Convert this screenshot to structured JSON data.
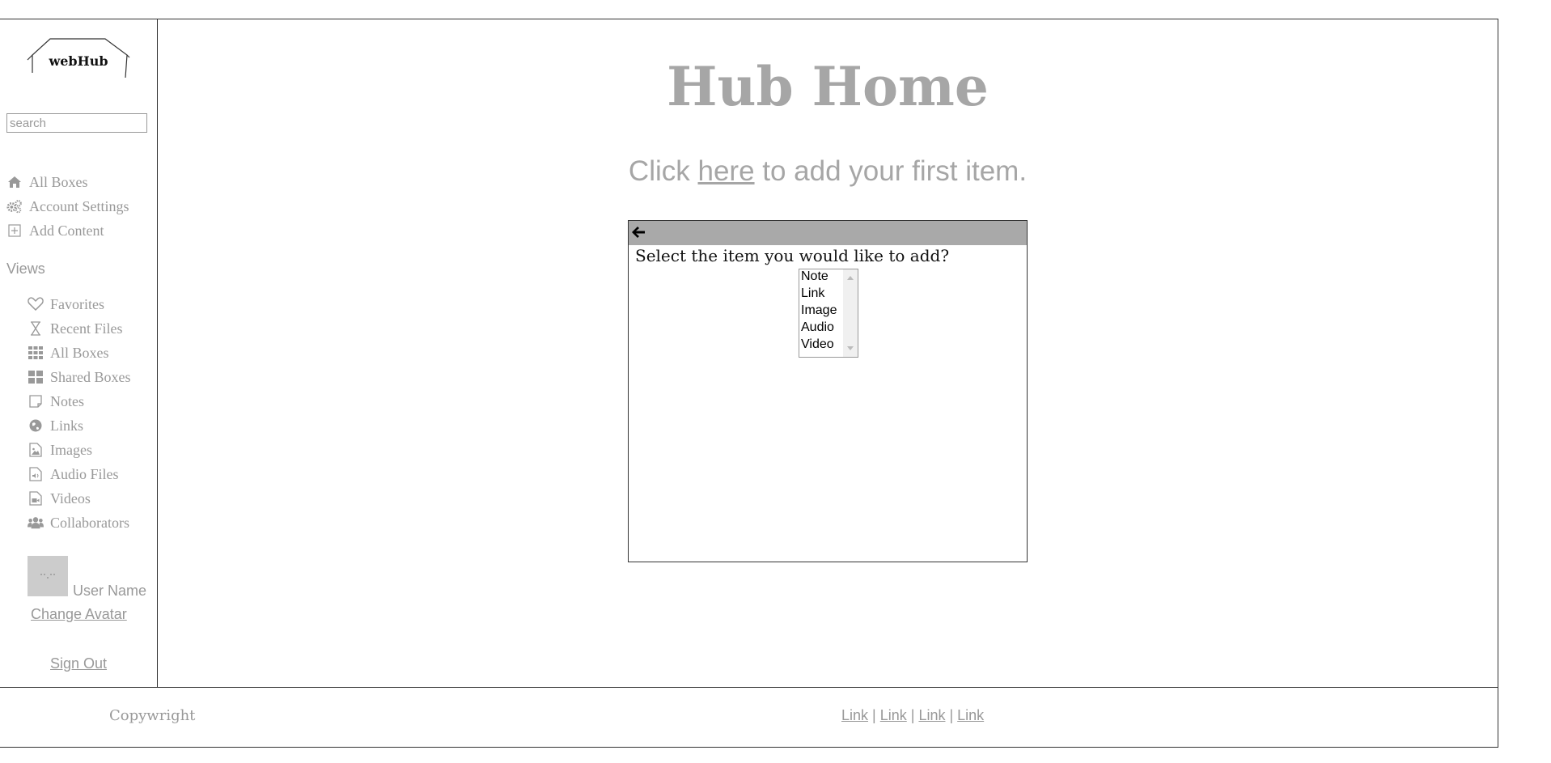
{
  "app": {
    "logo_text": "webHub"
  },
  "sidebar": {
    "search_placeholder": "search",
    "nav": [
      {
        "label": "All Boxes",
        "icon": "home-icon"
      },
      {
        "label": "Account Settings",
        "icon": "gears-icon"
      },
      {
        "label": "Add Content",
        "icon": "plus-square-icon"
      }
    ],
    "views_heading": "Views",
    "views": [
      {
        "label": "Favorites",
        "icon": "heart-icon"
      },
      {
        "label": "Recent Files",
        "icon": "hourglass-icon"
      },
      {
        "label": "All Boxes",
        "icon": "grid-icon"
      },
      {
        "label": "Shared Boxes",
        "icon": "tiles-icon"
      },
      {
        "label": "Notes",
        "icon": "note-icon"
      },
      {
        "label": "Links",
        "icon": "globe-icon"
      },
      {
        "label": "Images",
        "icon": "image-file-icon"
      },
      {
        "label": "Audio Files",
        "icon": "audio-file-icon"
      },
      {
        "label": "Videos",
        "icon": "video-file-icon"
      },
      {
        "label": "Collaborators",
        "icon": "users-icon"
      }
    ],
    "user_name": "User Name",
    "change_avatar": "Change Avatar",
    "sign_out": "Sign Out"
  },
  "main": {
    "title": "Hub Home",
    "subtitle_before": "Click ",
    "subtitle_link": "here",
    "subtitle_after": " to add your first item."
  },
  "dialog": {
    "question": "Select the item you would like to add?",
    "options": [
      "Note",
      "Link",
      "Image",
      "Audio",
      "Video"
    ]
  },
  "footer": {
    "copyright": "Copywright",
    "links": [
      "Link",
      "Link",
      "Link",
      "Link"
    ],
    "separator": "|"
  },
  "colors": {
    "text_muted": "#999999",
    "title_gray": "#a6a6a6",
    "dialog_bar": "#a9a9a9",
    "border": "#333333"
  }
}
